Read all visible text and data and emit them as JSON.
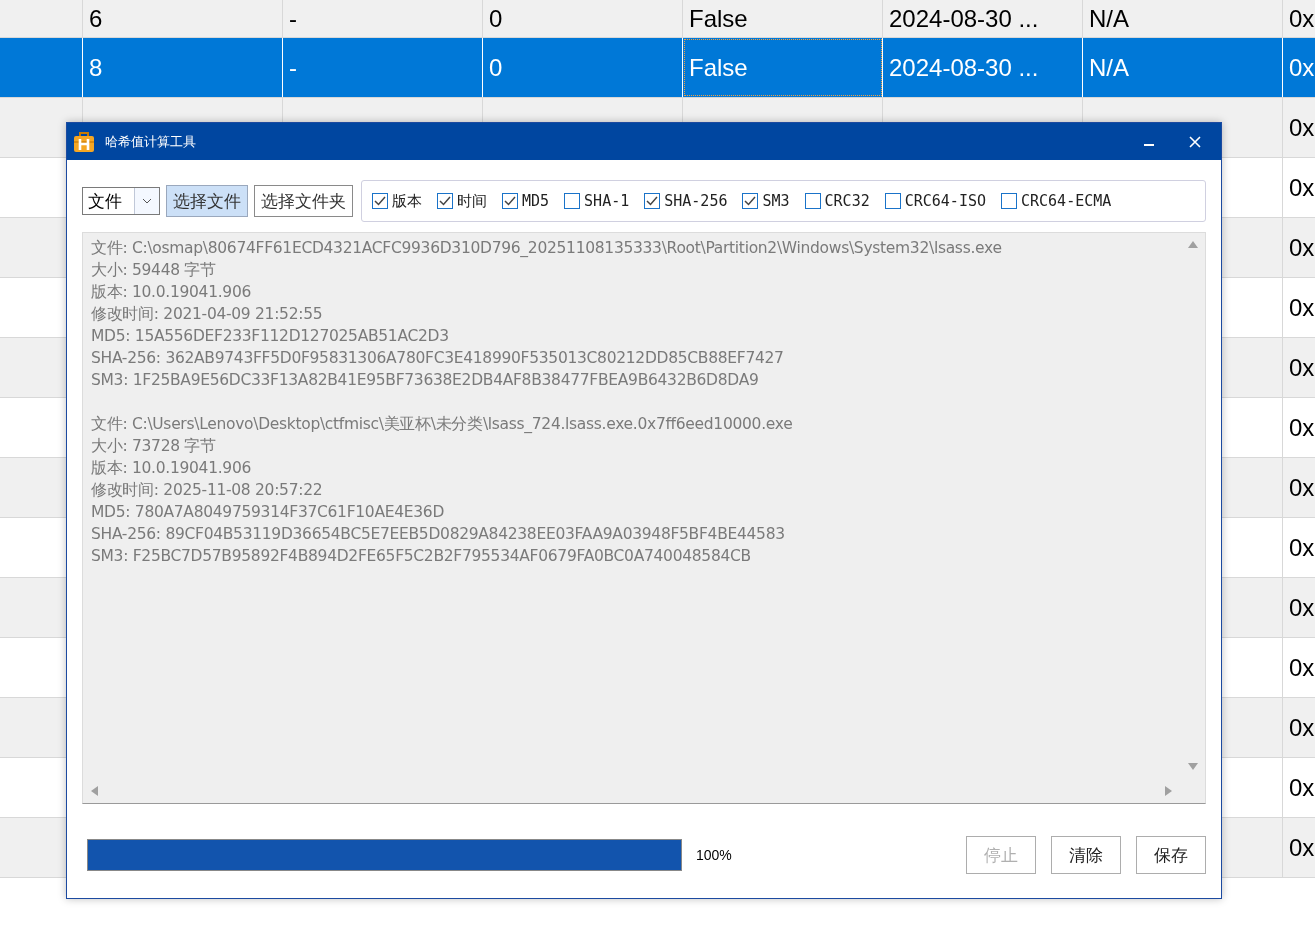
{
  "table": {
    "rows": [
      {
        "selected": false,
        "cells": [
          {
            "text": "6",
            "focused": false
          },
          {
            "text": "-",
            "focused": false
          },
          {
            "text": "0",
            "focused": false
          },
          {
            "text": "False",
            "focused": false
          },
          {
            "text": "2024-08-30 ...",
            "focused": false
          },
          {
            "text": "N/A",
            "focused": false
          },
          {
            "text": "0x",
            "focused": false
          }
        ]
      },
      {
        "selected": true,
        "cells": [
          {
            "text": "8",
            "focused": false
          },
          {
            "text": "-",
            "focused": false
          },
          {
            "text": "0",
            "focused": false
          },
          {
            "text": "False",
            "focused": true
          },
          {
            "text": "2024-08-30 ...",
            "focused": false
          },
          {
            "text": "N/A",
            "focused": false
          },
          {
            "text": "0x",
            "focused": false
          }
        ]
      },
      {
        "selected": false,
        "cells": [
          {
            "text": "0x",
            "focused": false
          }
        ]
      },
      {
        "selected": false,
        "cells": [
          {
            "text": "0x",
            "focused": false
          }
        ]
      },
      {
        "selected": false,
        "cells": [
          {
            "text": "0x",
            "focused": false
          }
        ]
      },
      {
        "selected": false,
        "cells": [
          {
            "text": "0x",
            "focused": false
          }
        ]
      },
      {
        "selected": false,
        "cells": [
          {
            "text": "0x",
            "focused": false
          }
        ]
      },
      {
        "selected": false,
        "cells": [
          {
            "text": "0x",
            "focused": false
          }
        ]
      },
      {
        "selected": false,
        "cells": [
          {
            "text": "0x",
            "focused": false
          }
        ]
      },
      {
        "selected": false,
        "cells": [
          {
            "text": "0x",
            "focused": false
          }
        ]
      },
      {
        "selected": false,
        "cells": [
          {
            "text": "0x",
            "focused": false
          }
        ]
      },
      {
        "selected": false,
        "cells": [
          {
            "text": "0x",
            "focused": false
          }
        ]
      },
      {
        "selected": false,
        "cells": [
          {
            "text": "0x",
            "focused": false
          }
        ]
      },
      {
        "selected": false,
        "cells": [
          {
            "text": "0x",
            "focused": false
          }
        ]
      },
      {
        "selected": false,
        "cells": [
          {
            "text": "0x",
            "focused": false
          }
        ]
      }
    ]
  },
  "dialog": {
    "title": "哈希值计算工具",
    "source_select": {
      "value": "文件"
    },
    "pick_buttons": [
      {
        "label": "选择文件",
        "selected": true
      },
      {
        "label": "选择文件夹",
        "selected": false
      }
    ],
    "options": [
      {
        "label": "版本",
        "checked": true
      },
      {
        "label": "时间",
        "checked": true
      },
      {
        "label": "MD5",
        "checked": true
      },
      {
        "label": "SHA-1",
        "checked": false
      },
      {
        "label": "SHA-256",
        "checked": true
      },
      {
        "label": "SM3",
        "checked": true
      },
      {
        "label": "CRC32",
        "checked": false
      },
      {
        "label": "CRC64-ISO",
        "checked": false
      },
      {
        "label": "CRC64-ECMA",
        "checked": false
      }
    ],
    "output": [
      {
        "lines": [
          "文件: C:\\osmap\\80674FF61ECD4321ACFC9936D310D796_20251108135333\\Root\\Partition2\\Windows\\System32\\lsass.exe",
          "大小: 59448 字节",
          "版本: 10.0.19041.906",
          "修改时间: 2021-04-09 21:52:55",
          "MD5: 15A556DEF233F112D127025AB51AC2D3",
          "SHA-256: 362AB9743FF5D0F95831306A780FC3E418990F535013C80212DD85CB88EF7427",
          "SM3: 1F25BA9E56DC33F13A82B41E95BF73638E2DB4AF8B38477FBEA9B6432B6D8DA9"
        ]
      },
      {
        "lines": [
          "文件: C:\\Users\\Lenovo\\Desktop\\ctfmisc\\美亚杯\\未分类\\lsass_724.lsass.exe.0x7ff6eed10000.exe",
          "大小: 73728 字节",
          "版本: 10.0.19041.906",
          "修改时间: 2025-11-08 20:57:22",
          "MD5: 780A7A8049759314F37C61F10AE4E36D",
          "SHA-256: 89CF04B53119D36654BC5E7EEB5D0829A84238EE03FAA9A03948F5BF4BE44583",
          "SM3: F25BC7D57B95892F4B894D2FE65F5C2B2F795534AF0679FA0BC0A740048584CB"
        ]
      }
    ],
    "progress": {
      "level": 1,
      "reading": "100%"
    },
    "actions": [
      {
        "label": "停止",
        "disabled": true
      },
      {
        "label": "清除",
        "disabled": false
      },
      {
        "label": "保存",
        "disabled": false
      }
    ]
  }
}
